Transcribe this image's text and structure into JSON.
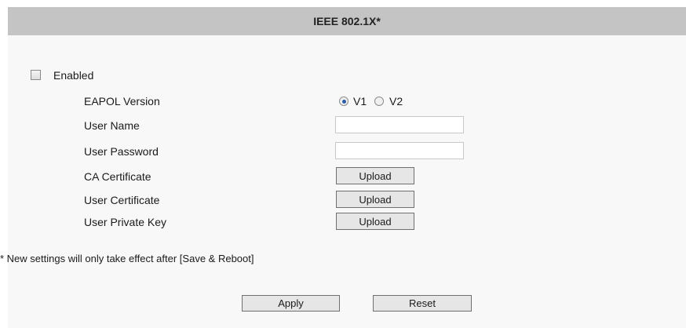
{
  "header": {
    "title": "IEEE 802.1X*"
  },
  "enabled": {
    "label": "Enabled",
    "checked": false
  },
  "eapol": {
    "label": "EAPOL Version",
    "options": [
      {
        "label": "V1",
        "selected": true
      },
      {
        "label": "V2",
        "selected": false
      }
    ]
  },
  "user_name": {
    "label": "User Name",
    "value": ""
  },
  "user_password": {
    "label": "User Password",
    "value": ""
  },
  "ca_certificate": {
    "label": "CA Certificate",
    "button": "Upload"
  },
  "user_certificate": {
    "label": "User Certificate",
    "button": "Upload"
  },
  "user_private_key": {
    "label": "User Private Key",
    "button": "Upload"
  },
  "note": "* New settings will only take effect after [Save & Reboot]",
  "actions": {
    "apply": "Apply",
    "reset": "Reset"
  }
}
